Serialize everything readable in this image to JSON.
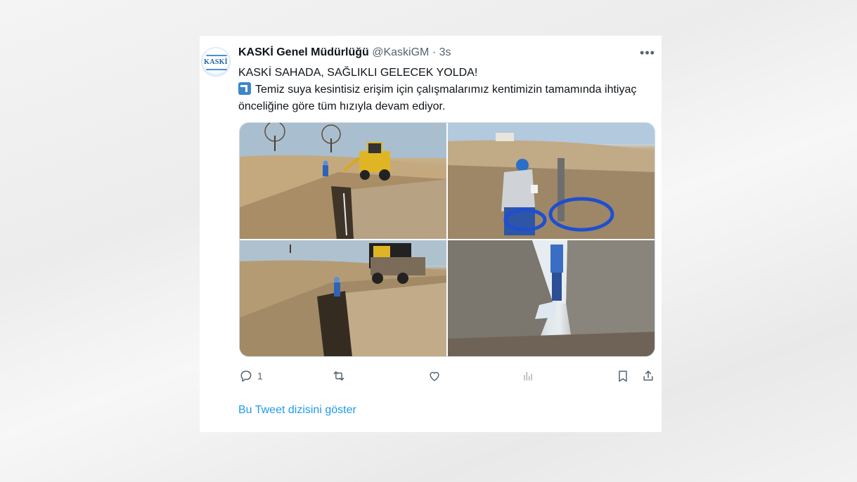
{
  "tweet": {
    "author_name": "KASKİ Genel Müdürlüğü",
    "handle": "@KaskiGM",
    "separator": "·",
    "time": "3s",
    "avatar_text": "KASKİ",
    "more_label": "•••",
    "line1": "KASKİ SAHADA, SAĞLIKLI GELECEK YOLDA!",
    "line2": "Temiz suya kesintisiz erişim için çalışmalarımız kentimizin tamamında ihtiyaç önceliğine göre tüm hızıyla devam ediyor.",
    "emoji_icon": "potable-water-icon",
    "photos": [
      {
        "name": "trench-backhoe-photo"
      },
      {
        "name": "worker-pipe-photo"
      },
      {
        "name": "trench-loader-photo"
      },
      {
        "name": "trench-worker-photo"
      }
    ],
    "actions": {
      "reply_count": "1",
      "retweet_count": "",
      "like_count": "",
      "views_count": ""
    },
    "thread_link": "Bu Tweet dizisini göster"
  },
  "colors": {
    "link": "#1d9bf0",
    "muted": "#536471",
    "text": "#0f1419"
  }
}
